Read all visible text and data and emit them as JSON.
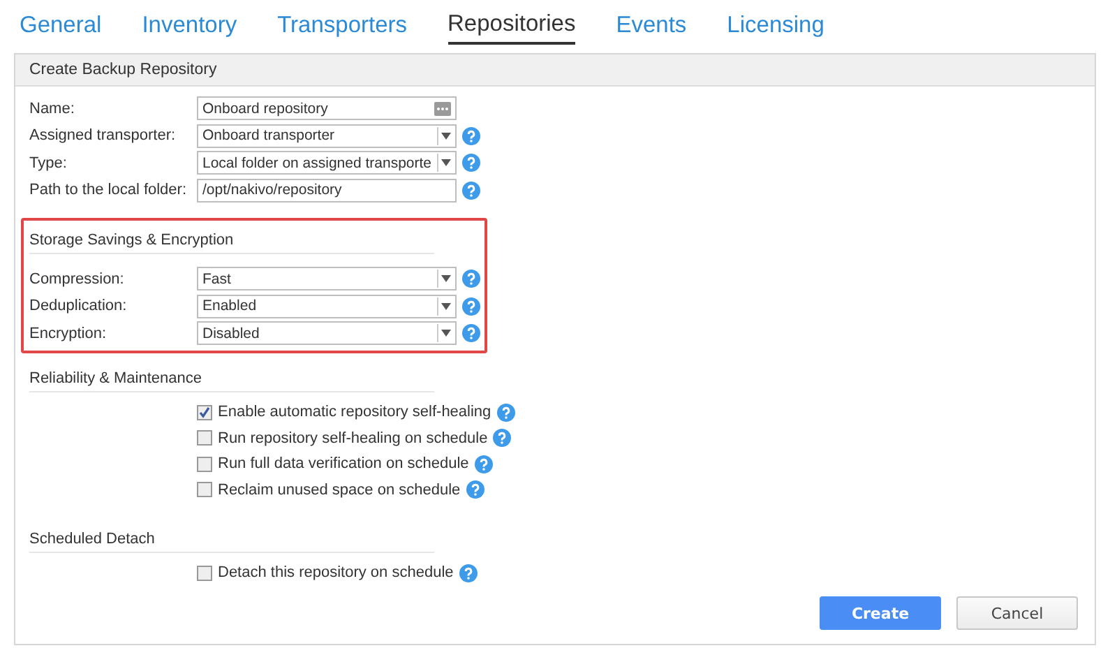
{
  "tabs": [
    {
      "label": "General",
      "selected": false
    },
    {
      "label": "Inventory",
      "selected": false
    },
    {
      "label": "Transporters",
      "selected": false
    },
    {
      "label": "Repositories",
      "selected": true
    },
    {
      "label": "Events",
      "selected": false
    },
    {
      "label": "Licensing",
      "selected": false
    }
  ],
  "panel": {
    "title": "Create Backup Repository",
    "sections": [
      {
        "fields": [
          {
            "label": "Name:",
            "kind": "text-button",
            "value": "Onboard repository",
            "help": false
          },
          {
            "label": "Assigned transporter:",
            "kind": "select",
            "value": "Onboard transporter",
            "help": true
          },
          {
            "label": "Type:",
            "kind": "select",
            "value": "Local folder on assigned transporte",
            "help": true
          },
          {
            "label": "Path to the local folder:",
            "kind": "text",
            "value": "/opt/nakivo/repository",
            "help": true
          }
        ]
      },
      {
        "title": "Storage Savings & Encryption",
        "highlighted": true,
        "fields": [
          {
            "label": "Compression:",
            "kind": "select",
            "value": "Fast",
            "help": true
          },
          {
            "label": "Deduplication:",
            "kind": "select",
            "value": "Enabled",
            "help": true
          },
          {
            "label": "Encryption:",
            "kind": "select",
            "value": "Disabled",
            "help": true
          }
        ]
      },
      {
        "title": "Reliability & Maintenance",
        "highlighted": false,
        "checkboxes": [
          {
            "label": "Enable automatic repository self-healing",
            "checked": true
          },
          {
            "label": "Run repository self-healing on schedule",
            "checked": false
          },
          {
            "label": "Run full data verification on schedule",
            "checked": false
          },
          {
            "label": "Reclaim unused space on schedule",
            "checked": false
          }
        ]
      },
      {
        "title": "Scheduled Detach",
        "highlighted": false,
        "checkboxes": [
          {
            "label": "Detach this repository on schedule",
            "checked": false
          }
        ]
      }
    ],
    "buttons": [
      {
        "label": "Create",
        "kind": "primary"
      },
      {
        "label": "Cancel",
        "kind": "secondary"
      }
    ]
  }
}
